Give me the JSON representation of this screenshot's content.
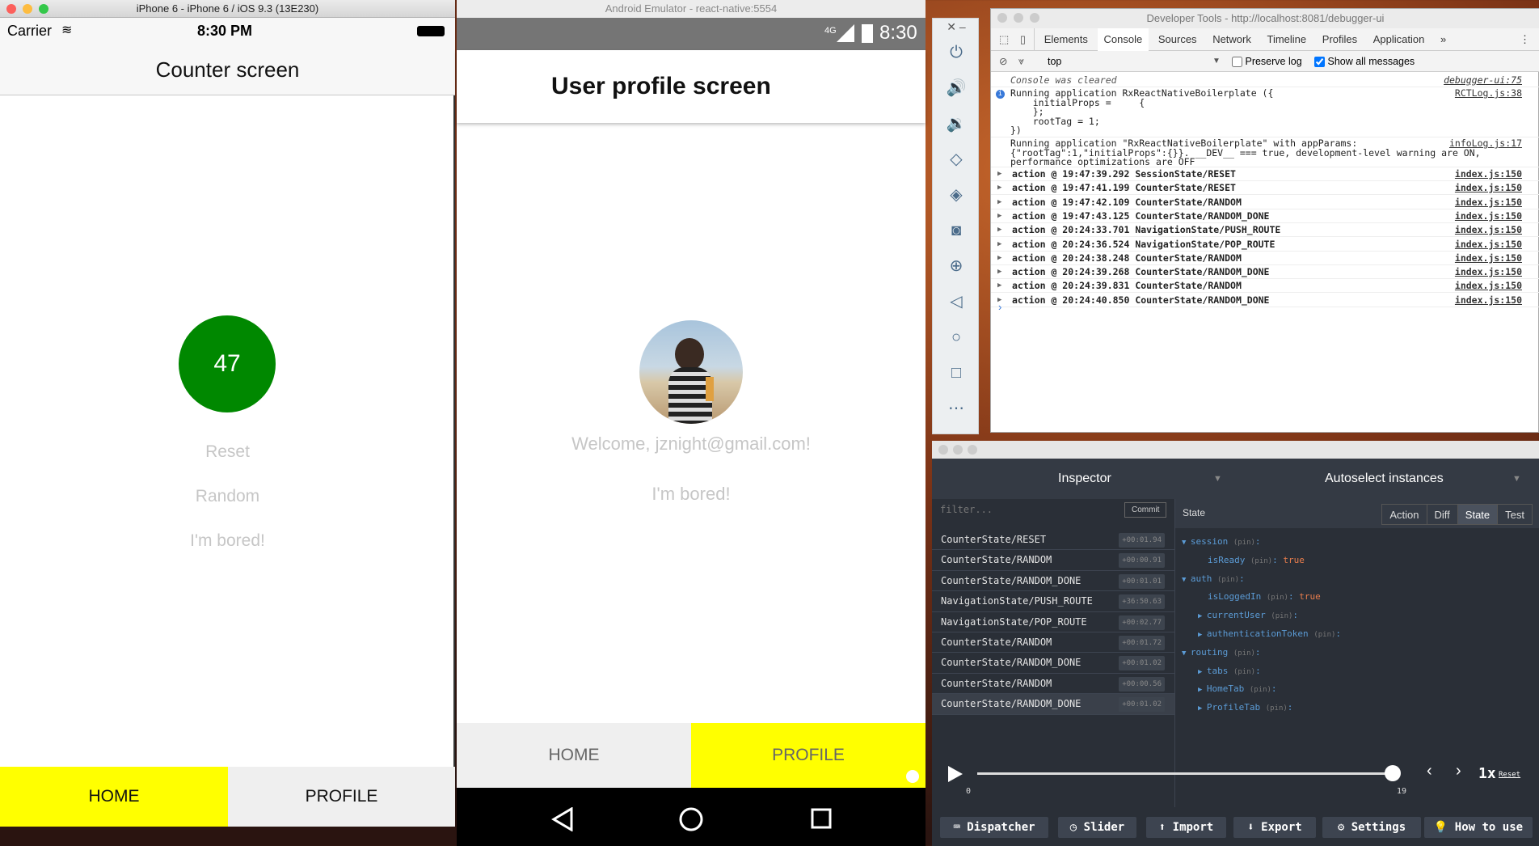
{
  "ios": {
    "window_title": "iPhone 6 - iPhone 6 / iOS 9.3 (13E230)",
    "carrier": "Carrier",
    "time": "8:30 PM",
    "nav_title": "Counter screen",
    "counter_value": "47",
    "buttons": [
      "Reset",
      "Random",
      "I'm bored!"
    ],
    "tabs": [
      "HOME",
      "PROFILE"
    ],
    "active_tab_color": "#ffff00",
    "counter_color": "#008800"
  },
  "android": {
    "window_title": "Android Emulator - react-native:5554",
    "network": "4G",
    "time": "8:30",
    "appbar_title": "User profile screen",
    "welcome": "Welcome, jznight@gmail.com!",
    "bored": "I'm bored!",
    "tabs": [
      "HOME",
      "PROFILE"
    ]
  },
  "devtools": {
    "window_title": "Developer Tools - http://localhost:8081/debugger-ui",
    "tabs": [
      "Elements",
      "Console",
      "Sources",
      "Network",
      "Timeline",
      "Profiles",
      "Application"
    ],
    "active_tab": "Console",
    "context": "top",
    "preserve_log": "Preserve log",
    "show_all": "Show all messages",
    "cleared": "Console was cleared",
    "cleared_src": "debugger-ui:75",
    "run1_lines": [
      "Running application RxReactNativeBoilerplate ({",
      "    initialProps =     {",
      "    };",
      "    rootTag = 1;",
      "})"
    ],
    "run1_src": "RCTLog.js:38",
    "run2_lines": [
      "Running application \"RxReactNativeBoilerplate\" with appParams:",
      "{\"rootTag\":1,\"initialProps\":{}}. __DEV__ === true, development-level warning are ON,",
      "performance optimizations are OFF"
    ],
    "run2_src": "infoLog.js:17",
    "actions": [
      "action @ 19:47:39.292 SessionState/RESET",
      "action @ 19:47:41.199 CounterState/RESET",
      "action @ 19:47:42.109 CounterState/RANDOM",
      "action @ 19:47:43.125 CounterState/RANDOM_DONE",
      "action @ 20:24:33.701 NavigationState/PUSH_ROUTE",
      "action @ 20:24:36.524 NavigationState/POP_ROUTE",
      "action @ 20:24:38.248 CounterState/RANDOM",
      "action @ 20:24:39.268 CounterState/RANDOM_DONE",
      "action @ 20:24:39.831 CounterState/RANDOM",
      "action @ 20:24:40.850 CounterState/RANDOM_DONE"
    ],
    "action_src": "index.js:150"
  },
  "remote": {
    "inspector": "Inspector",
    "autoselect": "Autoselect instances",
    "filter_placeholder": "filter...",
    "commit": "Commit",
    "state_label": "State",
    "view_tabs": [
      "Action",
      "Diff",
      "State",
      "Test"
    ],
    "actions": [
      {
        "name": "CounterState/RESET",
        "time": "+00:01.94"
      },
      {
        "name": "CounterState/RANDOM",
        "time": "+00:00.91"
      },
      {
        "name": "CounterState/RANDOM_DONE",
        "time": "+00:01.01"
      },
      {
        "name": "NavigationState/PUSH_ROUTE",
        "time": "+36:50.63"
      },
      {
        "name": "NavigationState/POP_ROUTE",
        "time": "+00:02.77"
      },
      {
        "name": "CounterState/RANDOM",
        "time": "+00:01.72"
      },
      {
        "name": "CounterState/RANDOM_DONE",
        "time": "+00:01.02"
      },
      {
        "name": "CounterState/RANDOM",
        "time": "+00:00.56"
      },
      {
        "name": "CounterState/RANDOM_DONE",
        "time": "+00:01.02"
      }
    ],
    "tree": [
      {
        "key": "session",
        "indent": 0,
        "open": true
      },
      {
        "key": "isReady",
        "indent": 1,
        "value": "true"
      },
      {
        "key": "auth",
        "indent": 0,
        "open": true
      },
      {
        "key": "isLoggedIn",
        "indent": 1,
        "value": "true"
      },
      {
        "key": "currentUser",
        "indent": 1,
        "open": false
      },
      {
        "key": "authenticationToken",
        "indent": 1,
        "open": false
      },
      {
        "key": "routing",
        "indent": 0,
        "open": true
      },
      {
        "key": "tabs",
        "indent": 1,
        "open": false
      },
      {
        "key": "HomeTab",
        "indent": 1,
        "open": false
      },
      {
        "key": "ProfileTab",
        "indent": 1,
        "open": false
      }
    ],
    "pin": "(pin)",
    "slider_min": "0",
    "slider_max": "19",
    "speed": "1x",
    "reset": "Reset",
    "slider_value": 1.0,
    "bottom_buttons": [
      "Dispatcher",
      "Slider",
      "Import",
      "Export",
      "Settings",
      "How to use"
    ]
  }
}
